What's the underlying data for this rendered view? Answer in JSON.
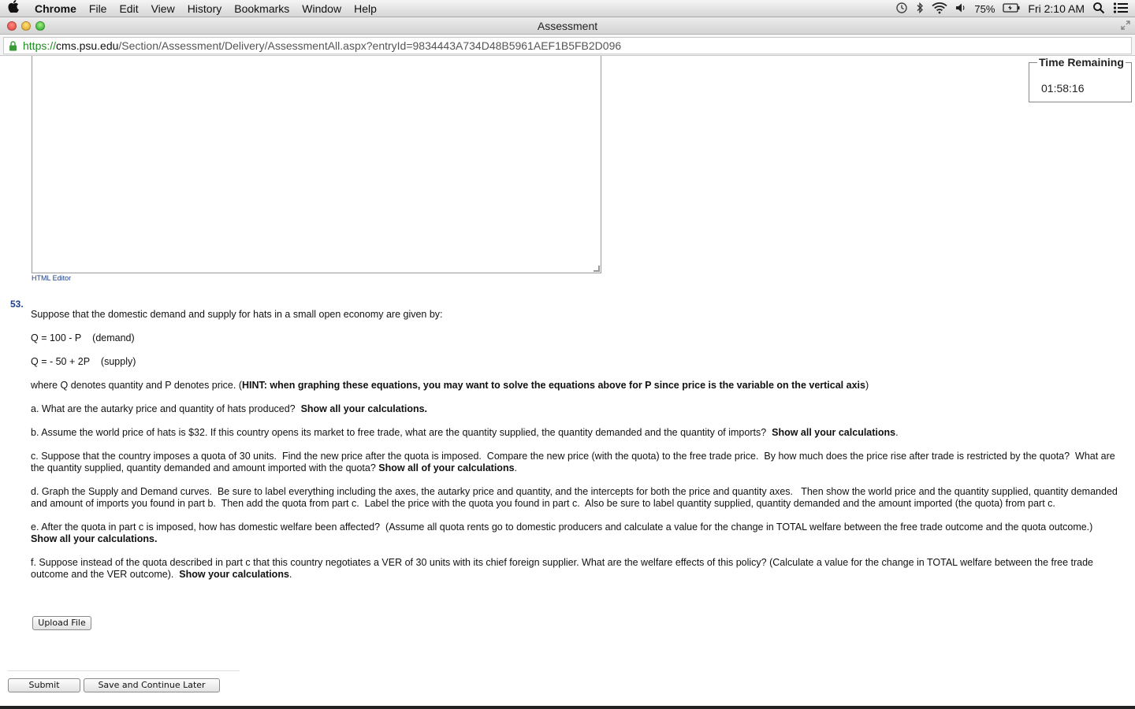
{
  "menubar": {
    "app_name": "Chrome",
    "items": [
      "File",
      "Edit",
      "View",
      "History",
      "Bookmarks",
      "Window",
      "Help"
    ],
    "battery": "75%",
    "clock": "Fri 2:10 AM"
  },
  "window": {
    "title": "Assessment"
  },
  "urlbar": {
    "scheme": "https://",
    "host": "cms.psu.edu",
    "path": "/Section/Assessment/Delivery/AssessmentAll.aspx?entryId=9834443A734D48B5961AEF1B5FB2D096"
  },
  "editor": {
    "link_label": "HTML Editor"
  },
  "timer": {
    "label": "Time Remaining",
    "value": "01:58:16"
  },
  "question": {
    "number": "53.",
    "intro": "Suppose that the domestic demand and supply for hats in a small open economy are given by:",
    "eq_demand": "Q = 100 - P    (demand)",
    "eq_supply": "Q = - 50 + 2P    (supply)",
    "where_pre": "where Q denotes quantity and P denotes price. (",
    "where_bold": "HINT: when graphing these equations, you may want to solve the equations above for P since price is the variable on the vertical axis",
    "where_post": ")",
    "a_text": "a. What are the autarky price and quantity of hats produced?  ",
    "a_bold": "Show all your calculations.",
    "b_text": "b. Assume the world price of hats is $32. If this country opens its market to free trade, what are the quantity supplied, the quantity demanded and the quantity of imports?  ",
    "b_bold": "Show all your calculations",
    "b_end": ".",
    "c_text": "c. Suppose that the country imposes a quota of 30 units.  Find the new price after the quota is imposed.  Compare the new price (with the quota) to the free trade price.  By how much does the price rise after trade is restricted by the quota?  What are the quantity supplied, quantity demanded and amount imported with the quota? ",
    "c_bold": "Show all of your calculations",
    "c_end": ".",
    "d_text": "d. Graph the Supply and Demand curves.  Be sure to label everything including the axes, the autarky price and quantity, and the intercepts for both the price and quantity axes.   Then show the world price and the quantity supplied, quantity demanded and amount of imports you found in part b.  Then add the quota from part c.  Label the price with the quota you found in part c.  Also be sure to label quantity supplied, quantity demanded and the amount imported (the quota) from part c.",
    "e_text": "e. After the quota in part c is imposed, how has domestic welfare been affected?  (Assume all quota rents go to domestic producers and calculate a value for the change in TOTAL welfare between the free trade outcome and the quota outcome.) ",
    "e_bold": "Show all your calculations.",
    "f_text": "f. Suppose instead of the quota described in part c that this country negotiates a VER of 30 units with its chief foreign supplier. What are the welfare effects of this policy? (Calculate a value for the change in TOTAL welfare between the free trade outcome and the VER outcome).  ",
    "f_bold": "Show your calculations",
    "f_end": "."
  },
  "buttons": {
    "upload": "Upload File",
    "submit": "Submit",
    "save": "Save and Continue Later"
  }
}
